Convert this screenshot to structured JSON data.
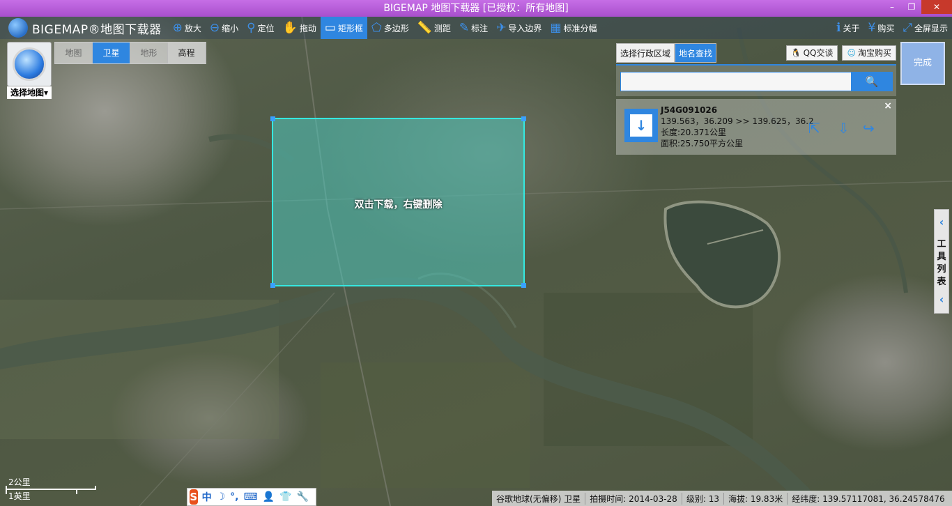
{
  "window": {
    "title": "BIGEMAP 地图下载器 [已授权：所有地图]",
    "minimize": "–",
    "restore": "❐",
    "close": "✕"
  },
  "toolbar": {
    "logo": "BIGEMAP®地图下载器",
    "tools": [
      {
        "label": "放大",
        "icon": "zoom-in-icon",
        "glyph": "⊕"
      },
      {
        "label": "缩小",
        "icon": "zoom-out-icon",
        "glyph": "⊖"
      },
      {
        "label": "定位",
        "icon": "location-pin-icon",
        "glyph": "⚲"
      },
      {
        "label": "拖动",
        "icon": "hand-icon",
        "glyph": "✋"
      },
      {
        "label": "矩形框",
        "icon": "rectangle-icon",
        "glyph": "▭",
        "active": true
      },
      {
        "label": "多边形",
        "icon": "polygon-icon",
        "glyph": "⬠"
      },
      {
        "label": "测距",
        "icon": "ruler-icon",
        "glyph": "📏"
      },
      {
        "label": "标注",
        "icon": "annotation-icon",
        "glyph": "✎"
      },
      {
        "label": "导入边界",
        "icon": "import-boundary-icon",
        "glyph": "✈"
      },
      {
        "label": "标准分幅",
        "icon": "grid-icon",
        "glyph": "▦"
      }
    ],
    "right_tools": [
      {
        "label": "关于",
        "icon": "about-icon",
        "glyph": "ℹ"
      },
      {
        "label": "购买",
        "icon": "buy-icon",
        "glyph": "¥"
      },
      {
        "label": "全屏显示",
        "icon": "fullscreen-icon",
        "glyph": "⤢"
      }
    ]
  },
  "select_map": {
    "label": "选择地图"
  },
  "map_types": [
    {
      "label": "地图",
      "state": "inactive"
    },
    {
      "label": "卫星",
      "state": "active"
    },
    {
      "label": "地形",
      "state": "inactive"
    },
    {
      "label": "高程",
      "state": "dark"
    }
  ],
  "selection": {
    "hint": "双击下载，右键删除"
  },
  "right_panel": {
    "tabs": [
      {
        "label": "选择行政区域",
        "active": false
      },
      {
        "label": "地名查找",
        "active": true
      }
    ],
    "qq_button": "QQ交谈",
    "taobao_button": "淘宝购买",
    "search_placeholder": "",
    "search_icon": "search-icon",
    "done": "完成"
  },
  "result": {
    "id": "J54G091026",
    "coords": "139.563，36.209 >> 139.625，36.2",
    "length": "长度:20.371公里",
    "area": "面积:25.750平方公里"
  },
  "side_tab": {
    "label_chars": [
      "工",
      "具",
      "列",
      "表"
    ]
  },
  "scale": {
    "km": "2公里",
    "mile": "1英里"
  },
  "ime": {
    "items": [
      "中",
      "☽",
      "°,",
      "⌨",
      "👤",
      "👕",
      "🔧"
    ]
  },
  "status": {
    "source": "谷歌地球(无偏移) 卫星",
    "capture_label": "拍摄时间:",
    "capture_date": "2014-03-28",
    "level_label": "级别:",
    "level": "13",
    "altitude_label": "海拔:",
    "altitude": "19.83米",
    "coord_label": "经纬度:",
    "coord": "139.57117081, 36.24578476"
  }
}
